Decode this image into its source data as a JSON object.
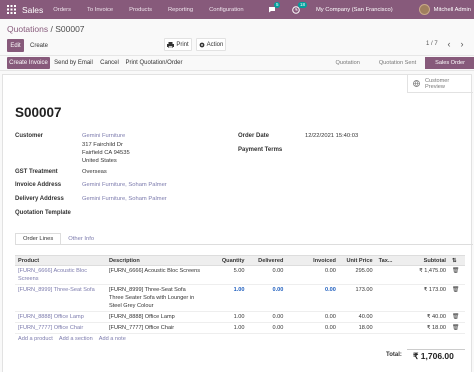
{
  "topbar": {
    "app_name": "Sales",
    "menus": [
      "Orders",
      "To Invoice",
      "Products",
      "Reporting",
      "Configuration"
    ],
    "chat_count": "5",
    "activity_count": "18",
    "company": "My Company (San Francisco)",
    "user": "Mitchell Admin"
  },
  "breadcrumb": {
    "parent": "Quotations",
    "sep": " / ",
    "current": "S00007"
  },
  "toolbar": {
    "edit": "Edit",
    "create": "Create",
    "print": "Print",
    "action": "Action",
    "pager": "1 / 7"
  },
  "actions": {
    "create_invoice": "Create Invoice",
    "send_email": "Send by Email",
    "cancel": "Cancel",
    "print_quotation": "Print Quotation/Order"
  },
  "status": {
    "stages": [
      "Quotation",
      "Quotation Sent",
      "Sales Order"
    ],
    "active": "Sales Order"
  },
  "smart_button": {
    "line1": "Customer",
    "line2": "Preview"
  },
  "order": {
    "name": "S00007",
    "customer_label": "Customer",
    "customer_name": "Gemini Furniture",
    "address1": "317 Fairchild Dr",
    "address2": "Fairfield CA 94535",
    "country": "United States",
    "gst_label": "GST Treatment",
    "gst_value": "Overseas",
    "invoice_addr_label": "Invoice Address",
    "invoice_addr_value": "Gemini Furniture, Soham Palmer",
    "delivery_addr_label": "Delivery Address",
    "delivery_addr_value": "Gemini Furniture, Soham Palmer",
    "template_label": "Quotation Template",
    "date_label": "Order Date",
    "date_value": "12/22/2021 15:40:03",
    "terms_label": "Payment Terms"
  },
  "tabs": {
    "order_lines": "Order Lines",
    "other_info": "Other Info"
  },
  "lines": {
    "columns": [
      "Product",
      "Description",
      "Quantity",
      "Delivered",
      "Invoiced",
      "Unit Price",
      "Tax...",
      "Subtotal"
    ],
    "rows": [
      {
        "product": "[FURN_6666] Acoustic Bloc Screens",
        "description": "[FURN_6666] Acoustic Bloc Screens",
        "qty": "5.00",
        "delivered": "0.00",
        "invoiced": "0.00",
        "price": "295.00",
        "tax": "",
        "subtotal": "₹ 1,475.00"
      },
      {
        "product": "[FURN_8999] Three-Seat Sofa",
        "description": "[FURN_8999] Three-Seat Sofa",
        "description2": "Three Seater Sofa with Lounger in Steel Grey Colour",
        "qty": "1.00",
        "delivered": "0.00",
        "invoiced": "0.00",
        "price": "173.00",
        "tax": "",
        "subtotal": "₹ 173.00"
      },
      {
        "product": "[FURN_8888] Office Lamp",
        "description": "[FURN_8888] Office Lamp",
        "qty": "1.00",
        "delivered": "0.00",
        "invoiced": "0.00",
        "price": "40.00",
        "tax": "",
        "subtotal": "₹ 40.00"
      },
      {
        "product": "[FURN_7777] Office Chair",
        "description": "[FURN_7777] Office Chair",
        "qty": "1.00",
        "delivered": "0.00",
        "invoiced": "0.00",
        "price": "18.00",
        "tax": "",
        "subtotal": "₹ 18.00"
      }
    ],
    "add_product": "Add a product",
    "add_section": "Add a section",
    "add_note": "Add a note"
  },
  "total": {
    "label": "Total:",
    "value": "₹ 1,706.00"
  }
}
